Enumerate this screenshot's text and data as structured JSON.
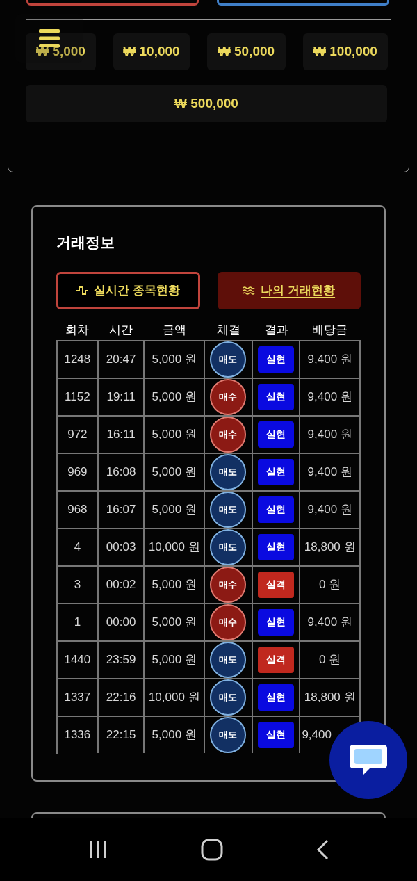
{
  "amount_chips": [
    "₩ 5,000",
    "₩ 10,000",
    "₩ 50,000",
    "₩ 100,000",
    "₩ 500,000"
  ],
  "trade_info": {
    "title": "거래정보",
    "tabs": [
      {
        "label": "실시간 종목현황",
        "selected": false
      },
      {
        "label": "나의 거래현황",
        "selected": true
      }
    ],
    "columns": [
      "회차",
      "시간",
      "금액",
      "체결",
      "결과",
      "배당금"
    ],
    "rows": [
      {
        "round": "1248",
        "time": "20:47",
        "amount": "5,000 원",
        "trade": {
          "kind": "sell",
          "label": "매도"
        },
        "result": {
          "kind": "win",
          "label": "실현"
        },
        "payout": "9,400 원"
      },
      {
        "round": "1152",
        "time": "19:11",
        "amount": "5,000 원",
        "trade": {
          "kind": "buy",
          "label": "매수"
        },
        "result": {
          "kind": "win",
          "label": "실현"
        },
        "payout": "9,400 원"
      },
      {
        "round": "972",
        "time": "16:11",
        "amount": "5,000 원",
        "trade": {
          "kind": "buy",
          "label": "매수"
        },
        "result": {
          "kind": "win",
          "label": "실현"
        },
        "payout": "9,400 원"
      },
      {
        "round": "969",
        "time": "16:08",
        "amount": "5,000 원",
        "trade": {
          "kind": "sell",
          "label": "매도"
        },
        "result": {
          "kind": "win",
          "label": "실현"
        },
        "payout": "9,400 원"
      },
      {
        "round": "968",
        "time": "16:07",
        "amount": "5,000 원",
        "trade": {
          "kind": "sell",
          "label": "매도"
        },
        "result": {
          "kind": "win",
          "label": "실현"
        },
        "payout": "9,400 원"
      },
      {
        "round": "4",
        "time": "00:03",
        "amount": "10,000 원",
        "trade": {
          "kind": "sell",
          "label": "매도"
        },
        "result": {
          "kind": "win",
          "label": "실현"
        },
        "payout": "18,800 원"
      },
      {
        "round": "3",
        "time": "00:02",
        "amount": "5,000 원",
        "trade": {
          "kind": "buy",
          "label": "매수"
        },
        "result": {
          "kind": "lose",
          "label": "실격"
        },
        "payout": "0 원"
      },
      {
        "round": "1",
        "time": "00:00",
        "amount": "5,000 원",
        "trade": {
          "kind": "buy",
          "label": "매수"
        },
        "result": {
          "kind": "win",
          "label": "실현"
        },
        "payout": "9,400 원"
      },
      {
        "round": "1440",
        "time": "23:59",
        "amount": "5,000 원",
        "trade": {
          "kind": "sell",
          "label": "매도"
        },
        "result": {
          "kind": "lose",
          "label": "실격"
        },
        "payout": "0 원"
      },
      {
        "round": "1337",
        "time": "22:16",
        "amount": "10,000 원",
        "trade": {
          "kind": "sell",
          "label": "매도"
        },
        "result": {
          "kind": "win",
          "label": "실현"
        },
        "payout": "18,800 원"
      },
      {
        "round": "1336",
        "time": "22:15",
        "amount": "5,000 원",
        "trade": {
          "kind": "sell",
          "label": "매도"
        },
        "result": {
          "kind": "win",
          "label": "실현"
        },
        "payout": "9,400"
      }
    ]
  }
}
